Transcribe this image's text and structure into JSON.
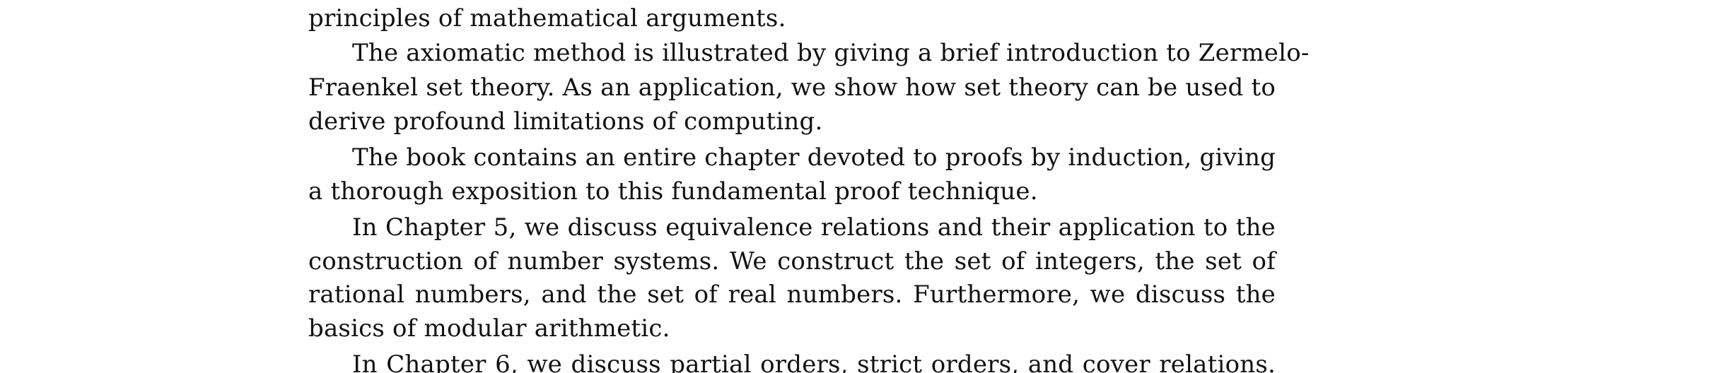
{
  "document": {
    "lines": [
      "principles of mathematical arguments.",
      "The axiomatic method is illustrated by giving a brief introduction to Zermelo-",
      "Fraenkel set theory. As an application, we show how set theory can be used to",
      "derive profound limitations of computing.",
      "The book contains an entire chapter devoted to proofs by induction, giving",
      "a thorough exposition to this fundamental proof technique.",
      "In Chapter 5, we discuss equivalence relations and their application to the",
      "construction of number systems. We construct the set of integers, the set of",
      "rational numbers, and the set of real numbers. Furthermore, we discuss the",
      "basics of modular arithmetic.",
      "In Chapter 6, we discuss partial orders, strict orders, and cover relations."
    ]
  }
}
